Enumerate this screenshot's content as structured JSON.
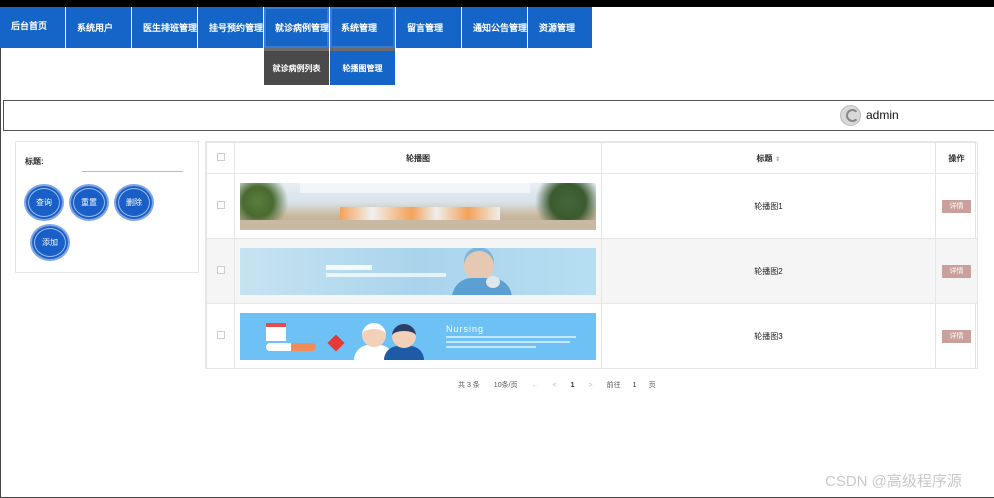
{
  "nav": {
    "items": [
      {
        "label": "后台首页"
      },
      {
        "label": "系统用户"
      },
      {
        "label": "医生排班管理"
      },
      {
        "label": "挂号预约管理"
      },
      {
        "label": "就诊病例管理"
      },
      {
        "label": "系统管理"
      },
      {
        "label": "留言管理"
      },
      {
        "label": "通知公告管理"
      },
      {
        "label": "资源管理"
      }
    ],
    "submenu_cases": {
      "label": "就诊病例列表"
    },
    "submenu_system": {
      "label": "轮播图管理"
    }
  },
  "user": {
    "name": "admin",
    "icon": "avatar-icon"
  },
  "search": {
    "title_label": "标题:",
    "title_value": "",
    "buttons": {
      "query": "查询",
      "reset": "重置",
      "delete": "删除",
      "add": "添加"
    }
  },
  "table": {
    "headers": {
      "image": "轮播图",
      "title": "标题",
      "action": "操作"
    },
    "rows": [
      {
        "title": "轮播图1",
        "action": "详情",
        "image_desc": "hospital lobby"
      },
      {
        "title": "轮播图2",
        "action": "详情",
        "image_desc": "doctor banner"
      },
      {
        "title": "轮播图3",
        "action": "详情",
        "image_desc": "Nursing"
      }
    ]
  },
  "pagination": {
    "total": "共 3 条",
    "page_size": "10条/页",
    "prev_more": "←",
    "prev": "<",
    "current_page": "1",
    "next": ">",
    "goto_label": "前往",
    "goto_value": "1",
    "page_unit": "页"
  },
  "banner_text": {
    "nursing_word": "Nursing"
  },
  "watermark": "CSDN @高级程序源",
  "colors": {
    "nav_blue": "#1565c9",
    "submenu_dark": "#4a4a4a",
    "detail_button": "#c9a09c"
  }
}
